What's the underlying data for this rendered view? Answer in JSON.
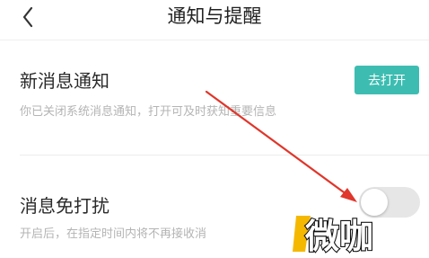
{
  "header": {
    "title": "通知与提醒",
    "back_icon": "chevron-left-icon"
  },
  "notifications": {
    "title": "新消息通知",
    "description": "你已关闭系统消息通知，打开可及时获知重要信息",
    "button_label": "去打开"
  },
  "dnd": {
    "title": "消息免打扰",
    "description": "开启后，在指定时间内将不再接收消",
    "toggle_on": false
  },
  "annotation": {
    "arrow_color": "#e0362b"
  },
  "watermark": {
    "text": "微咖"
  },
  "colors": {
    "accent": "#3dbdb1",
    "toggle_off": "#e6e6e6"
  }
}
